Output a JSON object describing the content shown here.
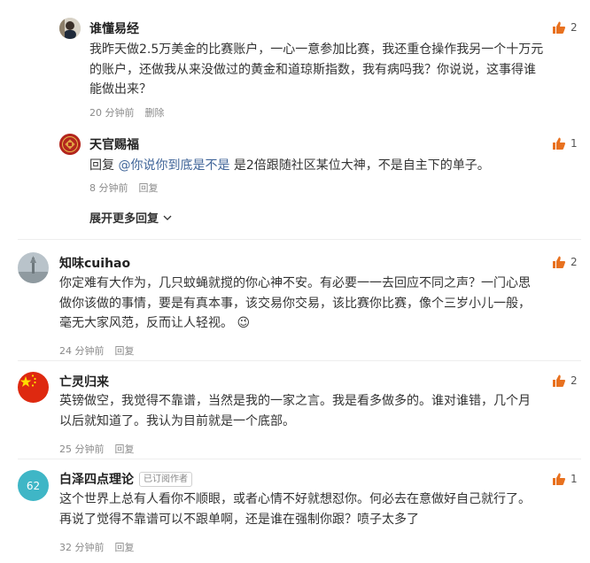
{
  "colors": {
    "like_orange": "#e8711f",
    "mention_blue": "#406599",
    "meta_gray": "#8a8a8a"
  },
  "replies": [
    {
      "name": "谁懂易经",
      "lines": [
        "我昨天做2.5万美金的比赛账户，一心一意参加比赛，我还重仓操作我另一个十万元",
        "的账户，还做我从来没做过的黄金和道琼斯指数，我有病吗我？你说说，这事得谁",
        "能做出来？"
      ],
      "time": "20 分钟前",
      "action": "删除",
      "likes": "2"
    },
    {
      "name": "天官赐福",
      "reply_prefix": "回复 ",
      "mention": "@你说你到底是不是",
      "text": " 是2倍跟随社区某位大神，不是自主下的单子。",
      "time": "8 分钟前",
      "action": "回复",
      "likes": "1"
    }
  ],
  "expand_label": "展开更多回复",
  "comments": [
    {
      "name": "知味cuihao",
      "lines": [
        "你定难有大作为，几只蚊蝇就搅的你心神不安。有必要一一去回应不同之声？一门心思",
        "做你该做的事情，要是有真本事，该交易你交易，该比赛你比赛，像个三岁小儿一般，",
        "毫无大家风范，反而让人轻视。"
      ],
      "emoji": "😉",
      "time": "24 分钟前",
      "action": "回复",
      "likes": "2"
    },
    {
      "name": "亡灵归来",
      "lines": [
        "英镑做空，我觉得不靠谱，当然是我的一家之言。我是看多做多的。谁对谁错，几个月",
        "以后就知道了。我认为目前就是一个底部。"
      ],
      "time": "25 分钟前",
      "action": "回复",
      "likes": "2"
    },
    {
      "name": "白泽四点理论",
      "badge": "已订阅作者",
      "avatar_text": "62",
      "lines": [
        "这个世界上总有人看你不顺眼，或者心情不好就想怼你。何必去在意做好自己就行了。",
        "再说了觉得不靠谱可以不跟单啊，还是谁在强制你跟？喷子太多了"
      ],
      "time": "32 分钟前",
      "action": "回复",
      "likes": "1"
    }
  ]
}
